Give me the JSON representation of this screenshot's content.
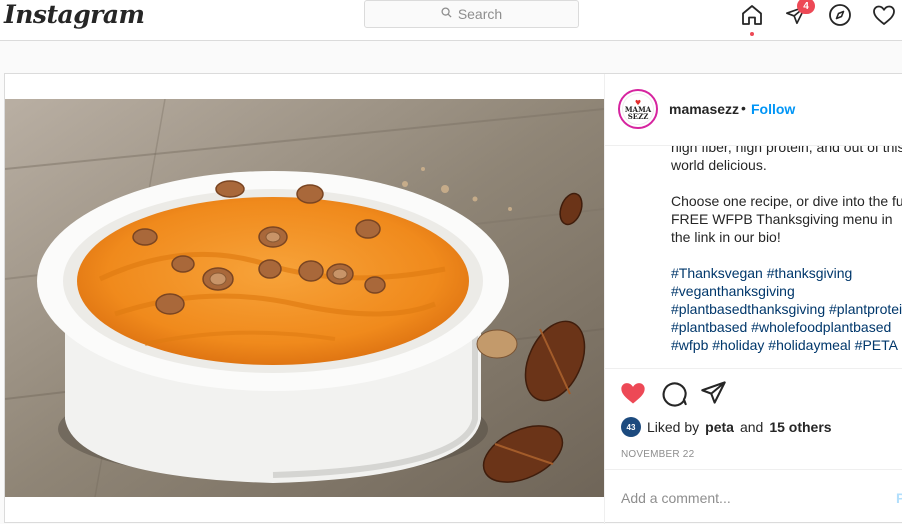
{
  "header": {
    "logo": "Instagram",
    "search_placeholder": "Search",
    "activity_badge": "4"
  },
  "post": {
    "username": "mamasezz",
    "separator": "•",
    "follow_label": "Follow",
    "avatar_text": [
      "MAMA",
      "SEZZ"
    ],
    "caption": [
      "high fiber, high protein, and out of this world delicious.",
      "Choose one recipe, or dive into the full FREE WFPB Thanksgiving menu in the link in our bio!"
    ],
    "hashtags": "#Thanksvegan #thanksgiving #veganthanksgiving #plantbasedthanksgiving #plantprotein #plantbased #wholefoodplantbased #wfpb #holiday #holidaymeal #PETA",
    "likes": {
      "prefix": "Liked by",
      "user": "peta",
      "and": "and",
      "others": "15 others",
      "avatar_text": "43"
    },
    "date": "NOVEMBER 22",
    "comment_placeholder": "Add a comment...",
    "post_button": "P"
  },
  "colors": {
    "accent": "#0095f6",
    "like": "#ed4956",
    "hashtag": "#00376b"
  }
}
